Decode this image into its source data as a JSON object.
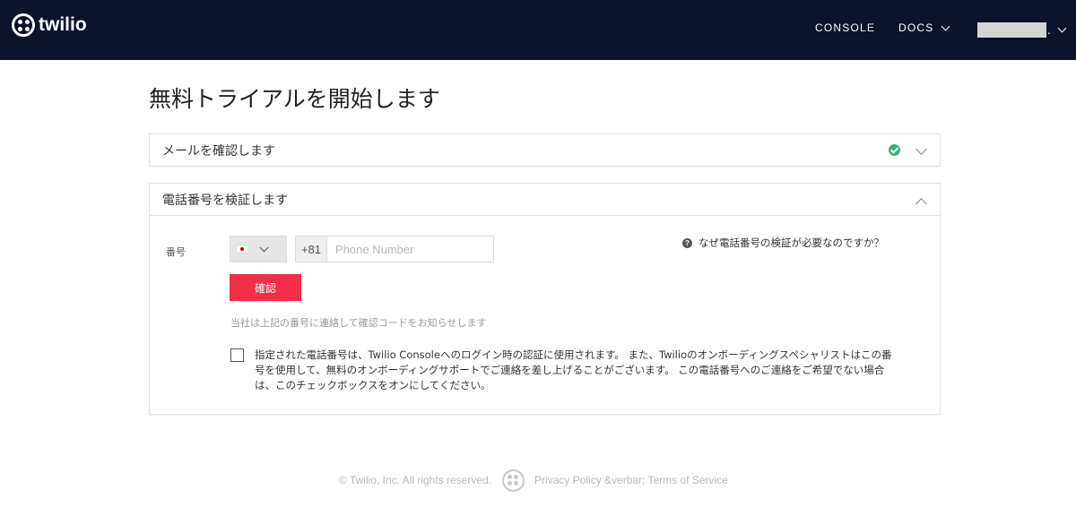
{
  "nav": {
    "logo_text": "twilio",
    "console_label": "CONSOLE",
    "docs_label": "DOCS",
    "account_suffix": "."
  },
  "page": {
    "title": "無料トライアルを開始します"
  },
  "email_section": {
    "title": "メールを確認します",
    "status": "verified"
  },
  "phone_section": {
    "title": "電話番号を検証します",
    "number_label": "番号",
    "country_flag": "jp-flag",
    "dial_code": "+81",
    "phone_placeholder": "Phone Number",
    "phone_value": "",
    "help_text": "なぜ電話番号の検証が必要なのですか？",
    "confirm_label": "確認",
    "note": "当社は上記の番号に連絡して確認コードをお知らせします",
    "consent_text": "指定された電話番号は、Twilio Consoleへのログイン時の認証に使用されます。 また、Twilioのオンボーディングスペシャリストはこの番号を使用して、無料のオンボーディングサポートでご連絡を差し上げることがございます。 この電話番号へのご連絡をご希望でない場合は、このチェックボックスをオンにしてください。",
    "consent_checked": false
  },
  "footer": {
    "copyright": "© Twilio, Inc. All rights reserved.",
    "links": "Privacy Policy &verbar; Terms of Service"
  },
  "colors": {
    "nav_bg": "#0d122b",
    "accent": "#f22f46",
    "success": "#36b37e"
  }
}
